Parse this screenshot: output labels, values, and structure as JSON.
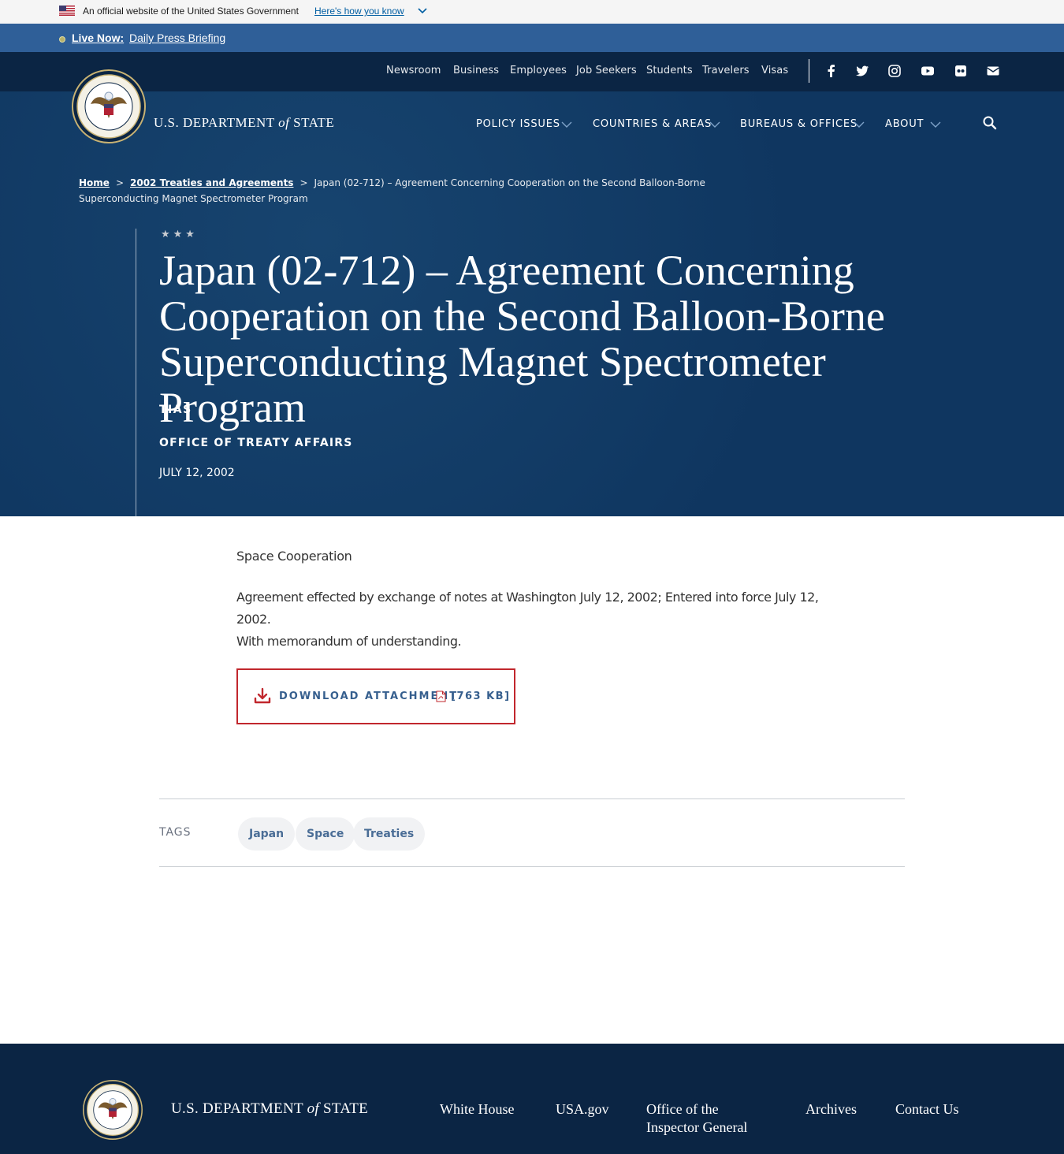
{
  "gov_banner": {
    "text": "An official website of the United States Government",
    "link": "Here's how you know"
  },
  "live_bar": {
    "label": "Live Now:",
    "link": "Daily Press Briefing"
  },
  "utility_nav": [
    "Newsroom",
    "Business",
    "Employees",
    "Job Seekers",
    "Students",
    "Travelers",
    "Visas"
  ],
  "social_icons": [
    "facebook-icon",
    "twitter-icon",
    "instagram-icon",
    "youtube-icon",
    "flickr-icon",
    "email-icon"
  ],
  "brand": {
    "prefix": "U.S. DEPARTMENT ",
    "of": "of",
    "suffix": " STATE"
  },
  "main_nav": [
    "POLICY ISSUES",
    "COUNTRIES & AREAS",
    "BUREAUS & OFFICES",
    "ABOUT"
  ],
  "breadcrumb": {
    "home": "Home",
    "parent": "2002 Treaties and Agreements",
    "current": "Japan (02-712) – Agreement Concerning Cooperation on the Second Balloon-Borne Superconducting Magnet Spectrometer Program",
    "separator": ">"
  },
  "article": {
    "stars": "★★★",
    "title": "Japan (02-712) – Agreement Concerning Cooperation on the Second Balloon-Borne Superconducting Magnet Spectrometer Program",
    "series": "TIAS",
    "office": "OFFICE OF TREATY AFFAIRS",
    "date": "JULY 12, 2002",
    "topic": "Space Cooperation",
    "description_line1": "Agreement effected by exchange of notes at Washington July 12, 2002; Entered into force July 12, 2002.",
    "description_line2": "With memorandum of understanding."
  },
  "download": {
    "label": "DOWNLOAD ATTACHMENT",
    "size": "[763 KB]"
  },
  "tags": {
    "label": "TAGS",
    "items": [
      "Japan",
      "Space",
      "Treaties"
    ]
  },
  "footer": {
    "links": [
      "White House",
      "USA.gov",
      "Office of the Inspector General",
      "Archives",
      "Contact Us"
    ]
  },
  "colors": {
    "header_bg": "#0f3660",
    "utility_bg": "#0b2544",
    "live_bar_bg": "#2f5f98",
    "download_border": "#c1272d",
    "link_blue": "#365f8e"
  }
}
